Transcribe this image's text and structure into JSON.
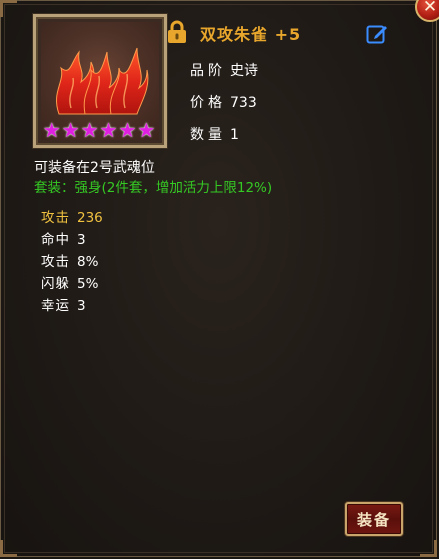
{
  "item": {
    "name": "双攻朱雀 +5",
    "star_count": 6,
    "quality_label": "品阶",
    "quality_value": "史诗",
    "price_label": "价格",
    "price_value": "733",
    "quantity_label": "数量",
    "quantity_value": "1"
  },
  "equip_slot_text": "可装备在2号武魂位",
  "set_bonus_text": "套装：强身(2件套，增加活力上限12%)",
  "stats": [
    {
      "label": "攻击",
      "value": "236"
    },
    {
      "label": "命中",
      "value": "3"
    },
    {
      "label": "攻击",
      "value": "8%"
    },
    {
      "label": "闪躲",
      "value": "5%"
    },
    {
      "label": "幸运",
      "value": "3"
    }
  ],
  "buttons": {
    "equip_label": "装备",
    "close_glyph": "✕"
  },
  "colors": {
    "item_name": "#e8a72c",
    "set_bonus": "#35c924",
    "highlight_stat": "#f0c240",
    "stars": "#e020e0"
  }
}
